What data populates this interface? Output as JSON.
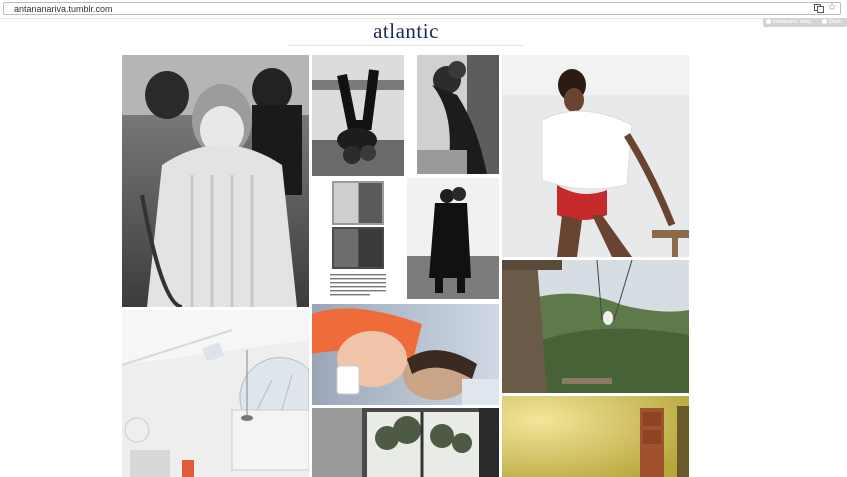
{
  "browser": {
    "url": "antananariva.tumblr.com",
    "translate_icon": "translate-icon",
    "star_icon": "bookmark-star-icon"
  },
  "tumblr_controls": {
    "edit_label": "Изменить тему",
    "home_label": "Dash"
  },
  "blog": {
    "title": "atlantic"
  },
  "photos": [
    "sweater-portrait",
    "upside-down-couple",
    "kissing-couple-bw",
    "woman-white-top",
    "magazine-page",
    "embracing-couple-road",
    "white-loft-interior",
    "couple-in-bed",
    "swing-over-valley",
    "window-view-trees",
    "yellow-room-door"
  ],
  "colors": {
    "title": "#1d2758",
    "background": "#ffffff"
  }
}
